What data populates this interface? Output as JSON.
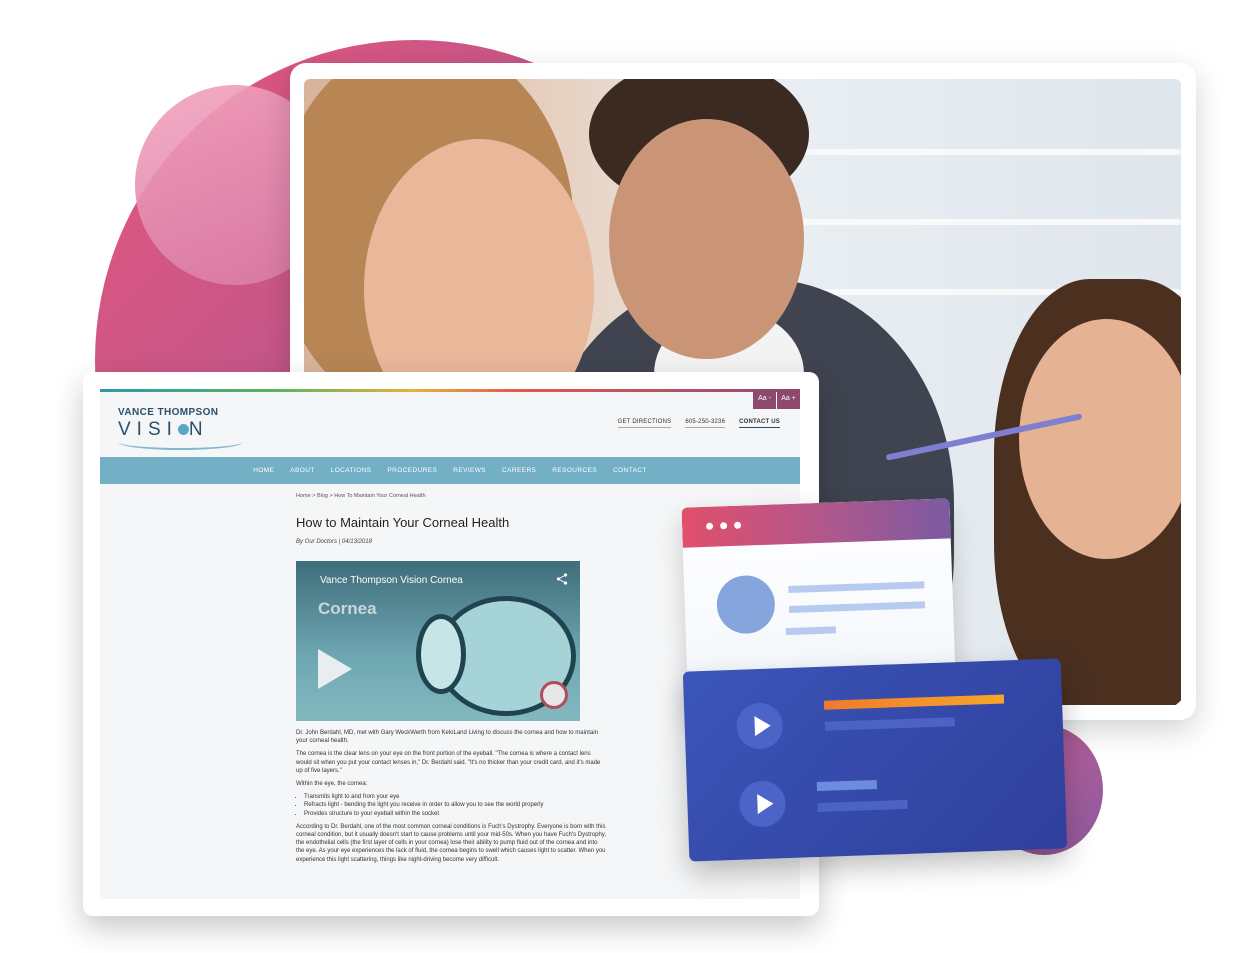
{
  "site": {
    "logo_line1": "VANCE THOMPSON",
    "logo_line2_a": "VISI",
    "logo_line2_b": "N",
    "font_decrease": "Aa -",
    "font_increase": "Aa +",
    "header_links": [
      "GET DIRECTIONS",
      "605-250-3236",
      "CONTACT US"
    ],
    "nav": [
      "HOME",
      "ABOUT",
      "LOCATIONS",
      "PROCEDURES",
      "REVIEWS",
      "CAREERS",
      "RESOURCES",
      "CONTACT"
    ]
  },
  "article": {
    "breadcrumb": "Home  >  Blog  >  How To Maintain Your Corneal Health",
    "title": "How to Maintain Your Corneal Health",
    "byline": "By Our Doctors | 04/13/2018",
    "video": {
      "title": "Vance Thompson Vision Cornea",
      "label": "Cornea"
    },
    "p1": "Dr. John Berdahl, MD, met with Gary WeckWerth from KeloLand Living to discuss the cornea and how to maintain your corneal health.",
    "p2": "The cornea is the clear lens on your eye on the front portion of the eyeball. \"The cornea is where a contact lens would sit when you put your contact lenses in,\" Dr. Berdahl said. \"It's no thicker than your credit card, and it's made up of five layers.\"",
    "p3": "Within the eye, the cornea:",
    "bullets": [
      "Transmits light to and from your eye",
      "Refracts light - bending the light you receive in order to allow you to see the world properly",
      "Provides structure to your eyeball within the socket"
    ],
    "p4": "According to Dr. Berdahl, one of the most common corneal conditions is Fuch's Dystrophy. Everyone is born with this corneal condition, but it usually doesn't start to cause problems until your mid-50s. When you have Fuch's Dystrophy, the endothelial cells (the first layer of cells in your cornea) lose their ability to pump fluid out of the cornea and into the eye. As your eye experiences the lack of fluid, the cornea begins to swell which causes light to scatter. When you experience this light scattering, things like night-driving become very difficult."
  },
  "colors": {
    "nav_bg": "#73afc5",
    "font_btn": "#8d4a6b",
    "panel": "#3b55b9",
    "accent_orange": "#f39a2b"
  },
  "icons": {
    "share": "share-icon",
    "play": "play-icon",
    "window_dots": "window-dots-icon"
  }
}
